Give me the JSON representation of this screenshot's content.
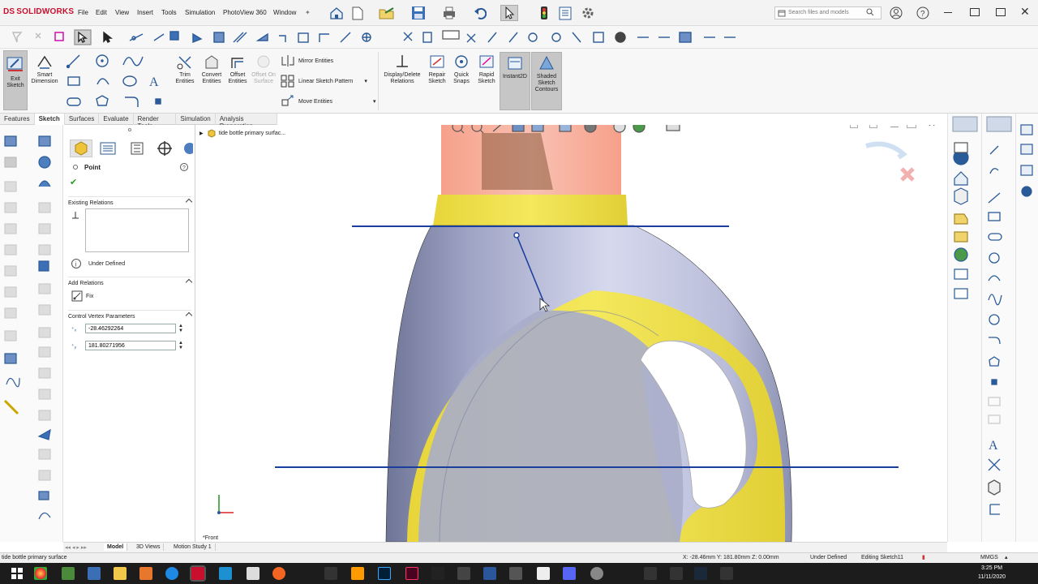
{
  "app": {
    "logo_text": "SOLIDWORKS",
    "logo_mark": "DS"
  },
  "menu": [
    "File",
    "Edit",
    "View",
    "Insert",
    "Tools",
    "Simulation",
    "PhotoView 360",
    "Window"
  ],
  "search": {
    "placeholder": "Search files and models"
  },
  "command_manager": {
    "exit_sketch": "Exit Sketch",
    "smart_dimension": "Smart Dimension",
    "trim_entities": "Trim Entities",
    "convert_entities": "Convert Entities",
    "offset_entities": "Offset Entities",
    "offset_on_surface": "Offset On Surface",
    "mirror_entities": "Mirror Entities",
    "linear_sketch_pattern": "Linear Sketch Pattern",
    "move_entities": "Move Entities",
    "display_delete_relations": "Display/Delete Relations",
    "repair_sketch": "Repair Sketch",
    "quick_snaps": "Quick Snaps",
    "rapid_sketch": "Rapid Sketch",
    "instant2d": "Instant2D",
    "shaded_sketch_contours": "Shaded Sketch Contours"
  },
  "tabs": [
    {
      "label": "Features",
      "active": false
    },
    {
      "label": "Sketch",
      "active": true
    },
    {
      "label": "Surfaces",
      "active": false
    },
    {
      "label": "Evaluate",
      "active": false
    },
    {
      "label": "Render Tools",
      "active": false
    },
    {
      "label": "Simulation",
      "active": false
    },
    {
      "label": "Analysis Preparation",
      "active": false
    }
  ],
  "property_manager": {
    "title": "Point",
    "existing_relations_label": "Existing Relations",
    "under_defined": "Under Defined",
    "add_relations_label": "Add Relations",
    "fix_label": "Fix",
    "control_vertex_label": "Control Vertex Parameters",
    "x_value": "-28.46292264",
    "y_value": "181.80271956"
  },
  "tree": {
    "item_label": "tide bottle primary surfac..."
  },
  "viewport": {
    "view_label": "*Front"
  },
  "bottom_tabs": [
    {
      "label": "Model",
      "active": true
    },
    {
      "label": "3D Views",
      "active": false
    },
    {
      "label": "Motion Study 1",
      "active": false
    }
  ],
  "status": {
    "left": "tide bottle primary surface",
    "coords": "X: -28.46mm Y: 181.80mm Z: 0.00mm",
    "definition": "Under Defined",
    "editing": "Editing Sketch11",
    "units": "MMGS"
  },
  "taskbar": {
    "time": "3:25 PM",
    "date": "11/11/2020"
  },
  "colors": {
    "accent_blue": "#1f5fa8",
    "sketch_line": "#1a3f9c",
    "bottle_yellow": "#f0e24a",
    "bottle_body": "#b9bdd6",
    "cap_orange": "#f4a38e",
    "logo_red": "#c8102e"
  }
}
